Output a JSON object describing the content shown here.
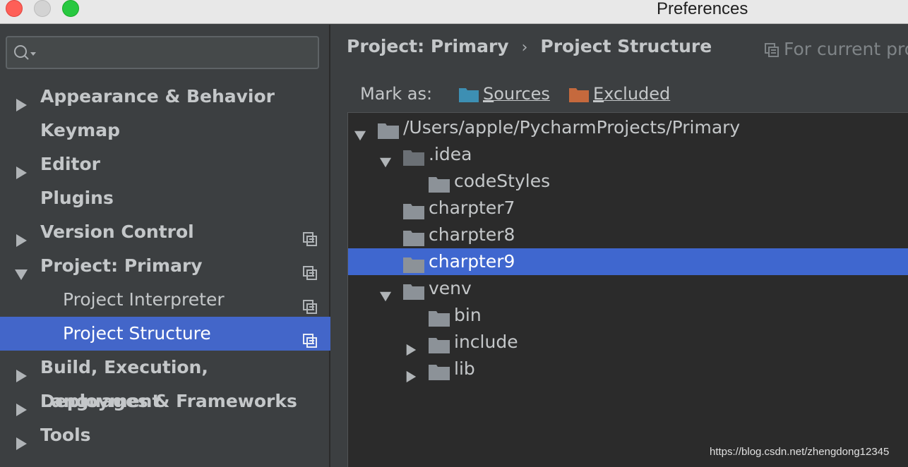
{
  "window": {
    "title": "Preferences"
  },
  "search": {
    "placeholder": ""
  },
  "sidebar": {
    "items": [
      {
        "label": "Appearance & Behavior",
        "expandable": true,
        "expanded": false
      },
      {
        "label": "Keymap",
        "expandable": false
      },
      {
        "label": "Editor",
        "expandable": true,
        "expanded": false
      },
      {
        "label": "Plugins",
        "expandable": false
      },
      {
        "label": "Version Control",
        "expandable": true,
        "expanded": false,
        "copy_icon": true
      },
      {
        "label": "Project: Primary",
        "expandable": true,
        "expanded": true,
        "copy_icon": true
      },
      {
        "label": "Project Interpreter",
        "sub": true,
        "copy_icon": true
      },
      {
        "label": "Project Structure",
        "sub": true,
        "selected": true,
        "copy_icon": true
      },
      {
        "label": "Build, Execution, Deployment",
        "expandable": true,
        "expanded": false
      },
      {
        "label": "Languages & Frameworks",
        "expandable": true,
        "expanded": false
      },
      {
        "label": "Tools",
        "expandable": true,
        "expanded": false
      }
    ]
  },
  "main": {
    "breadcrumb": {
      "parent": "Project: Primary",
      "separator": "›",
      "current": "Project Structure"
    },
    "for_current": "For current pro",
    "mark_as": {
      "label": "Mark as:",
      "sources": {
        "prefix": "S",
        "rest": "ources",
        "color": "#3d8fb3"
      },
      "excluded": {
        "prefix": "E",
        "rest": "xcluded",
        "color": "#c5693d"
      }
    },
    "tree": [
      {
        "label": "/Users/apple/PycharmProjects/Primary",
        "depth": 0,
        "toggle": "expanded"
      },
      {
        "label": ".idea",
        "depth": 1,
        "toggle": "expanded",
        "dim_folder": true
      },
      {
        "label": "codeStyles",
        "depth": 2,
        "toggle": "none"
      },
      {
        "label": "charpter7",
        "depth": 1,
        "toggle": "none"
      },
      {
        "label": "charpter8",
        "depth": 1,
        "toggle": "none"
      },
      {
        "label": "charpter9",
        "depth": 1,
        "toggle": "none",
        "selected": true
      },
      {
        "label": "venv",
        "depth": 1,
        "toggle": "expanded"
      },
      {
        "label": "bin",
        "depth": 2,
        "toggle": "none"
      },
      {
        "label": "include",
        "depth": 2,
        "toggle": "collapsed"
      },
      {
        "label": "lib",
        "depth": 2,
        "toggle": "collapsed"
      }
    ]
  },
  "watermark": "https://blog.csdn.net/zhengdong12345",
  "colors": {
    "selection": "#4366c9",
    "panel_bg": "#3c3f41",
    "tree_bg": "#2b2b2b",
    "folder": "#8c9298",
    "folder_dim": "#6b7075"
  }
}
